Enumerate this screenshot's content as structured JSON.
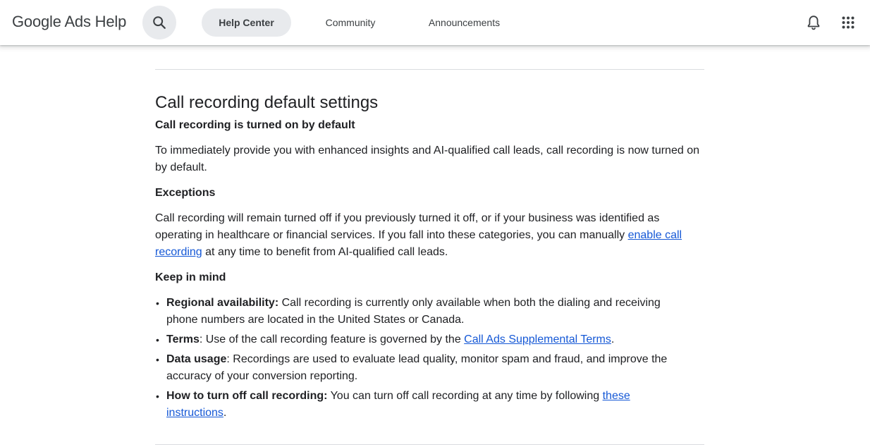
{
  "header": {
    "brand": "Google Ads Help",
    "tabs": [
      {
        "label": "Help Center",
        "active": true
      },
      {
        "label": "Community",
        "active": false
      },
      {
        "label": "Announcements",
        "active": false
      }
    ],
    "icons": [
      "search-icon",
      "notifications-bell-icon",
      "apps-grid-icon"
    ]
  },
  "article": {
    "title": "Call recording default settings",
    "sections": {
      "default_heading": "Call recording is turned on by default",
      "default_text": "To immediately provide you with enhanced insights and AI-qualified call leads, call recording is now turned on by default.",
      "exceptions_heading": "Exceptions",
      "exceptions_text_before": "Call recording will remain turned off if you previously turned it off, or if your business was identified as operating in healthcare or financial services. If you fall into these categories, you can manually ",
      "exceptions_link": "enable call recording",
      "exceptions_text_after": " at any time to benefit from AI-qualified call leads.",
      "keep_heading": "Keep in mind"
    },
    "bullets": [
      {
        "bold": "Regional availability:",
        "text": " Call recording is currently only available when both the dialing and receiving phone numbers are located in the United States or Canada.",
        "link": "",
        "after": ""
      },
      {
        "bold": "Terms",
        "text": ": Use of the call recording feature is governed by the ",
        "link": "Call Ads Supplemental Terms",
        "after": "."
      },
      {
        "bold": "Data usage",
        "text": ": Recordings are used to evaluate lead quality, monitor spam and fraud, and improve the accuracy of your conversion reporting.",
        "link": "",
        "after": ""
      },
      {
        "bold": "How to turn off call recording:",
        "text": " You can turn off call recording at any time by following ",
        "link": "these instructions",
        "after": "."
      }
    ]
  },
  "colors": {
    "link": "#1558d6",
    "tab_active_bg": "#e8eaed",
    "divider": "#dadce0"
  }
}
